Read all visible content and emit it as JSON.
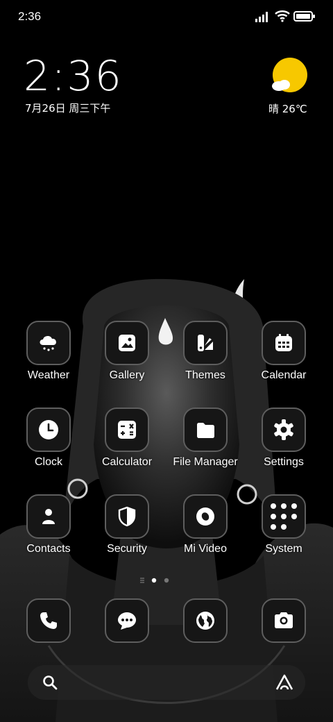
{
  "status_bar": {
    "time": "2:36"
  },
  "lock_widget": {
    "time": "2:36",
    "date": "7月26日 周三下午",
    "weather": "晴 26℃"
  },
  "apps": [
    {
      "label": "Weather",
      "icon": "cloud-rain-icon"
    },
    {
      "label": "Gallery",
      "icon": "image-icon"
    },
    {
      "label": "Themes",
      "icon": "brush-icon"
    },
    {
      "label": "Calendar",
      "icon": "calendar-icon"
    },
    {
      "label": "Clock",
      "icon": "clock-icon"
    },
    {
      "label": "Calculator",
      "icon": "calculator-icon"
    },
    {
      "label": "File Manager",
      "icon": "folder-icon"
    },
    {
      "label": "Settings",
      "icon": "gear-icon"
    },
    {
      "label": "Contacts",
      "icon": "person-icon"
    },
    {
      "label": "Security",
      "icon": "shield-icon"
    },
    {
      "label": "Mi Video",
      "icon": "play-icon"
    },
    {
      "label": "System",
      "icon": "folder-grid-icon"
    }
  ],
  "dock": [
    {
      "icon": "phone-icon"
    },
    {
      "icon": "message-icon"
    },
    {
      "icon": "browser-icon"
    },
    {
      "icon": "camera-icon"
    }
  ],
  "colors": {
    "tile_bg": "#161616",
    "tile_border": "#5e5e5e",
    "sun": "#f7c800"
  }
}
